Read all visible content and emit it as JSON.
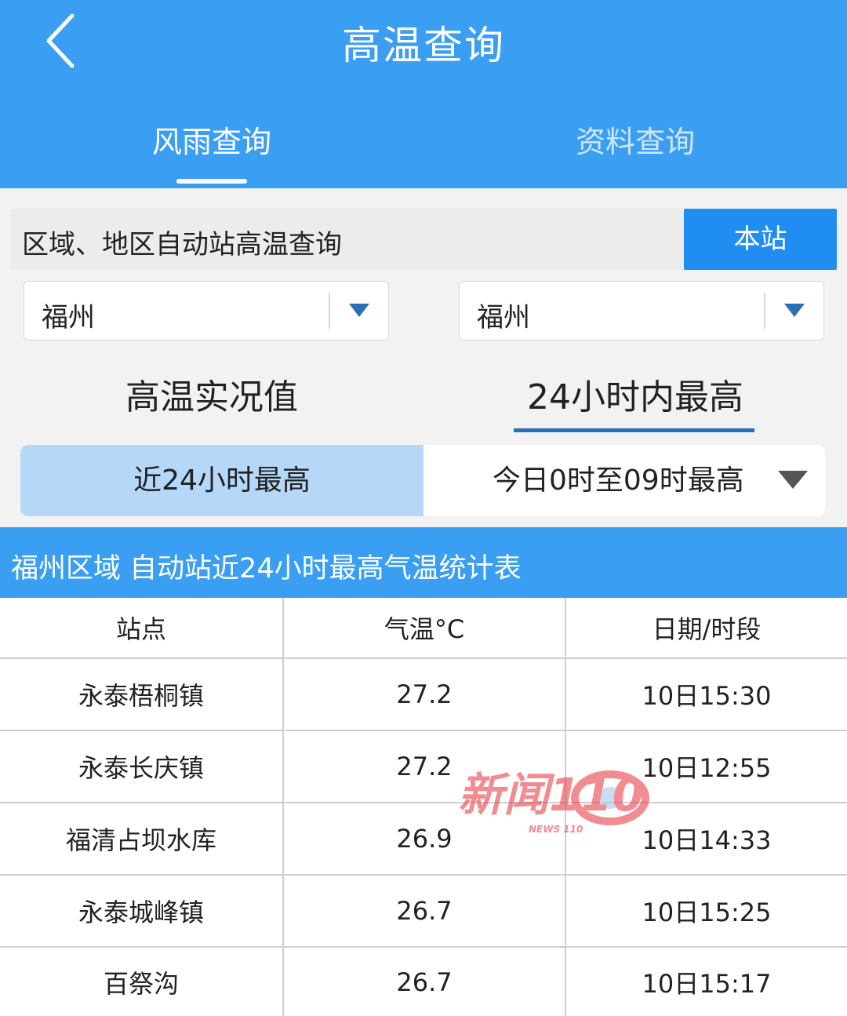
{
  "header": {
    "title": "高温查询",
    "tabs": [
      {
        "label": "风雨查询",
        "active": true
      },
      {
        "label": "资料查询",
        "active": false
      }
    ]
  },
  "query": {
    "label": "区域、地区自动站高温查询",
    "station_button": "本站"
  },
  "selects": {
    "left_value": "福州",
    "right_value": "福州"
  },
  "mode_tabs": [
    {
      "label": "高温实况值",
      "active": false
    },
    {
      "label": "24小时内最高",
      "active": true
    }
  ],
  "segment": {
    "left_label": "近24小时最高",
    "right_label": "今日0时至09时最高"
  },
  "table": {
    "title": "福州区域 自动站近24小时最高气温统计表",
    "columns": [
      "站点",
      "气温°C",
      "日期/时段"
    ],
    "rows": [
      {
        "station": "永泰梧桐镇",
        "temp": "27.2",
        "time": "10日15:30"
      },
      {
        "station": "永泰长庆镇",
        "temp": "27.2",
        "time": "10日12:55"
      },
      {
        "station": "福清占坝水库",
        "temp": "26.9",
        "time": "10日14:33"
      },
      {
        "station": "永泰城峰镇",
        "temp": "26.7",
        "time": "10日15:25"
      },
      {
        "station": "百祭沟",
        "temp": "26.7",
        "time": "10日15:17"
      }
    ]
  },
  "watermark": {
    "text": "新闻110",
    "subtext": "NEWS 110"
  },
  "colors": {
    "header_blue": "#3a9ef2",
    "button_blue": "#1f8ef0",
    "segment_selected": "#b5d7f8",
    "underline_blue": "#2b6fb5"
  }
}
